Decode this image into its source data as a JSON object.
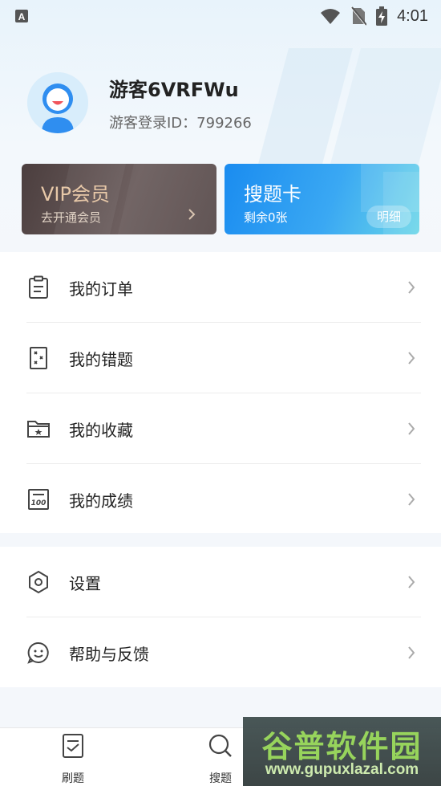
{
  "status_bar": {
    "time": "4:01",
    "left_icon": "a-notification-icon",
    "icons": [
      "wifi-icon",
      "no-sim-icon",
      "battery-charging-icon"
    ]
  },
  "profile": {
    "name": "游客6VRFWu",
    "uid_label": "游客登录ID：799266"
  },
  "vip_card": {
    "title": "VIP会员",
    "subtitle": "去开通会员"
  },
  "search_card": {
    "title": "搜题卡",
    "subtitle": "剩余0张",
    "button": "明细"
  },
  "menu_group_1": [
    {
      "label": "我的订单",
      "icon": "order-icon"
    },
    {
      "label": "我的错题",
      "icon": "wrong-question-icon"
    },
    {
      "label": "我的收藏",
      "icon": "folder-star-icon"
    },
    {
      "label": "我的成绩",
      "icon": "score-icon"
    }
  ],
  "menu_group_2": [
    {
      "label": "设置",
      "icon": "settings-icon"
    },
    {
      "label": "帮助与反馈",
      "icon": "feedback-icon"
    }
  ],
  "tabbar": [
    {
      "label": "刷题",
      "icon": "practice-icon"
    },
    {
      "label": "搜题",
      "icon": "search-question-icon"
    }
  ],
  "watermark": {
    "title": "谷普软件园",
    "url": "www.gupuxlazal.com"
  }
}
